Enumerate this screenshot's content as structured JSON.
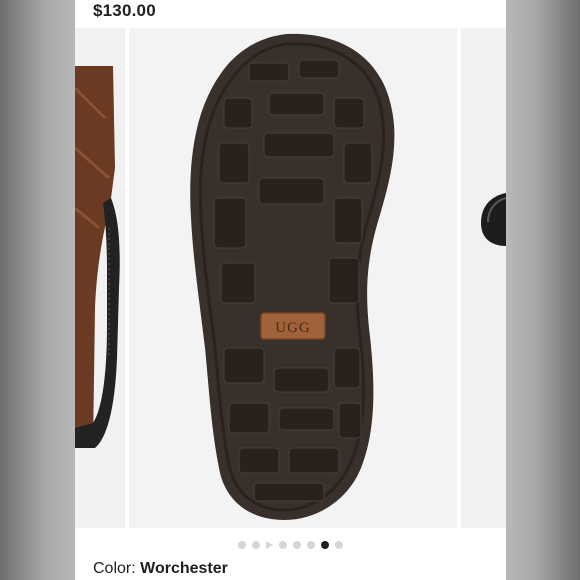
{
  "product": {
    "price": "$130.00",
    "color_label": "Color: ",
    "color_value": "Worchester"
  },
  "carousel": {
    "sole_logo_text": "UGG",
    "dots": [
      {
        "kind": "dot",
        "active": false
      },
      {
        "kind": "dot",
        "active": false
      },
      {
        "kind": "play",
        "active": false
      },
      {
        "kind": "dot",
        "active": false
      },
      {
        "kind": "dot",
        "active": false
      },
      {
        "kind": "dot",
        "active": false
      },
      {
        "kind": "dot",
        "active": true
      },
      {
        "kind": "dot",
        "active": false
      }
    ]
  },
  "colors": {
    "boot_leather": "#6b3a22",
    "sole_rubber": "#3a302b",
    "logo_patch": "#a0623a"
  }
}
